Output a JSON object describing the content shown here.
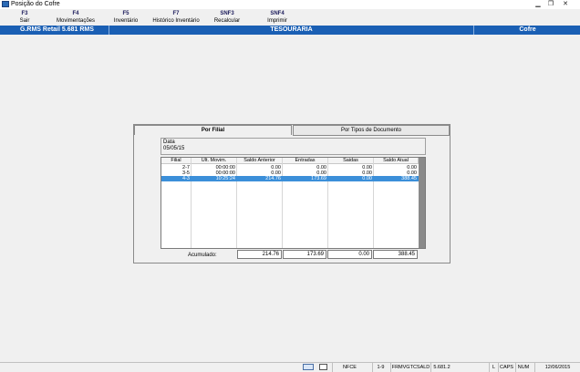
{
  "window": {
    "title": "Posição do Cofre",
    "minimize_icon": "minimize-icon",
    "restore_icon": "restore-icon",
    "close_icon": "close-icon",
    "minimize_glyph": "▁",
    "restore_glyph": "❐",
    "close_glyph": "✕"
  },
  "toolbar": {
    "items": [
      {
        "key": "F3",
        "label": "Sair"
      },
      {
        "key": "F4",
        "label": "Movimentações"
      },
      {
        "key": "F5",
        "label": "Inventário"
      },
      {
        "key": "F7",
        "label": "Histórico Inventário"
      },
      {
        "key": "SNF3",
        "label": "Recalcular"
      },
      {
        "key": "SNF4",
        "label": "Imprimir"
      }
    ]
  },
  "header": {
    "system": "G.RMS Retail 5.681 RMS",
    "module": "TESOURARIA",
    "section": "Cofre"
  },
  "tabs": [
    {
      "label": "Por Filial",
      "active": true
    },
    {
      "label": "Por Tipos de Documento",
      "active": false
    }
  ],
  "date": {
    "label": "Data",
    "value": "05/05/15"
  },
  "grid": {
    "columns": [
      "Filial",
      "Ult. Movim.",
      "Saldo Anterior",
      "Entradas",
      "Saidas",
      "Saldo Atual"
    ],
    "rows": [
      {
        "filial": "2-7",
        "ult_movim": "00:00:00",
        "saldo_anterior": "0.00",
        "entradas": "0.00",
        "saidas": "0.00",
        "saldo_atual": "0.00",
        "selected": false
      },
      {
        "filial": "3-5",
        "ult_movim": "00:00:00",
        "saldo_anterior": "0.00",
        "entradas": "0.00",
        "saidas": "0.00",
        "saldo_atual": "0.00",
        "selected": false
      },
      {
        "filial": "4-3",
        "ult_movim": "10:25:24",
        "saldo_anterior": "214.76",
        "entradas": "173.69",
        "saidas": "0.00",
        "saldo_atual": "388.45",
        "selected": true
      }
    ]
  },
  "accumulated": {
    "label": "Acumulado:",
    "saldo_anterior": "214.76",
    "entradas": "173.69",
    "saidas": "0.00",
    "saldo_atual": "388.45"
  },
  "statusbar": {
    "mode": "NFCE",
    "page": "1-9",
    "program": "FRMVGTCSALD",
    "version": "5.681.2",
    "caps_l": "L",
    "caps": "CAPS",
    "num": "NUM",
    "date": "12/06/2015"
  },
  "colors": {
    "header_bg": "#1a5fb4",
    "selected_row": "#3b8fd9"
  }
}
